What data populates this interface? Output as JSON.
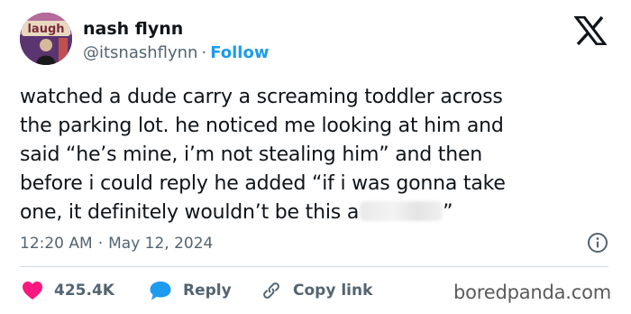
{
  "author": {
    "display_name": "nash flynn",
    "handle": "@itsnashflynn",
    "separator": "·",
    "follow_label": "Follow",
    "avatar_sign_text": "laugh"
  },
  "tweet": {
    "lines": [
      "watched a dude carry a screaming toddler across",
      "the parking lot. he noticed me looking at him and",
      "said “he’s mine, i’m not stealing him” and then",
      "before i could reply he added “if i was gonna take"
    ],
    "last_line_prefix": "one, it definitely wouldn’t be this a",
    "last_line_suffix": "”"
  },
  "meta": {
    "time": "12:20 AM",
    "separator": "·",
    "date": "May 12, 2024"
  },
  "actions": {
    "like_count": "425.4K",
    "reply_label": "Reply",
    "copy_label": "Copy link"
  },
  "watermark": "boredpanda.com",
  "icons": {
    "like": "heart-icon",
    "reply": "speech-bubble-icon",
    "copy": "link-icon",
    "info": "info-icon",
    "brand": "x-logo-icon"
  },
  "colors": {
    "text": "#0f1419",
    "secondary": "#536471",
    "accent": "#1d9bf0",
    "like": "#f91880",
    "divider": "#cfd9de"
  }
}
